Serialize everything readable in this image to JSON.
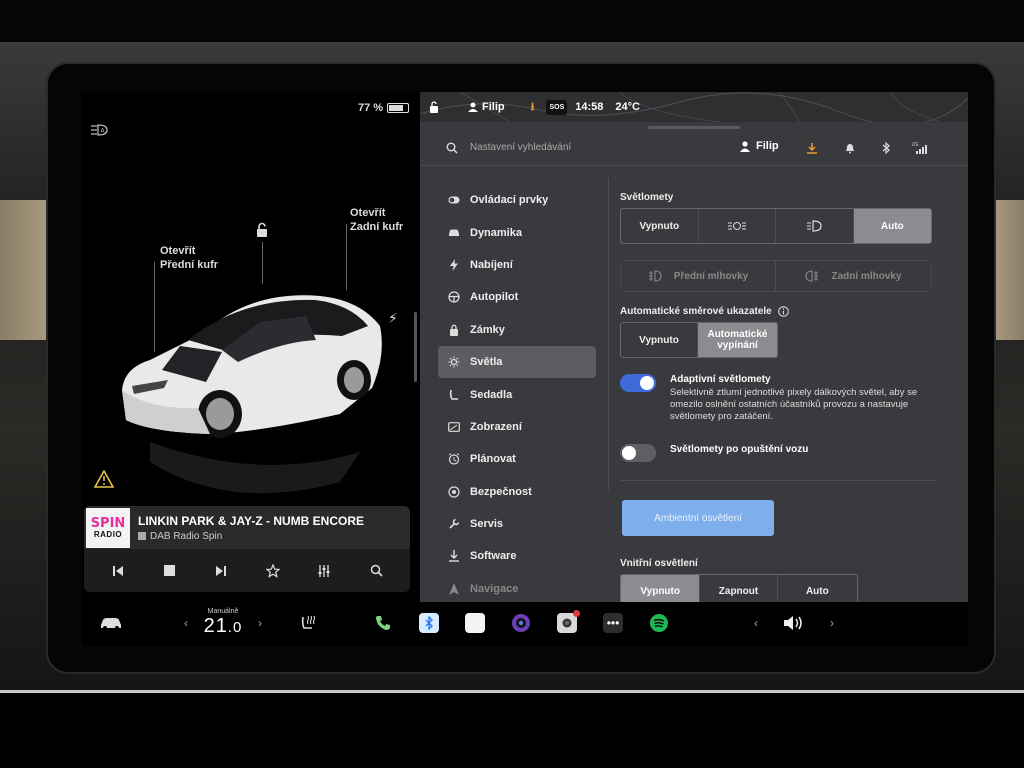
{
  "left_panel": {
    "battery_percent": "77 %",
    "battery_level": 0.77,
    "label_front_trunk": {
      "action": "Otevřít",
      "target": "Přední kufr"
    },
    "label_rear_trunk": {
      "action": "Otevřít",
      "target": "Zadní kufr"
    }
  },
  "media": {
    "logo_line1": "SPIN",
    "logo_line2": "RADIO",
    "track_title": "LINKIN PARK & JAY-Z - NUMB ENCORE",
    "station": "DAB Radio Spin",
    "controls": [
      "previous-icon",
      "stop-icon",
      "next-icon",
      "favorite-icon",
      "equalizer-icon",
      "search-icon"
    ]
  },
  "status_bar": {
    "user": "Filip",
    "sos": "SOS",
    "time": "14:58",
    "temperature": "24°C"
  },
  "search": {
    "placeholder": "Nastavení vyhledávání",
    "profile_name": "Filip"
  },
  "nav": {
    "items": [
      {
        "label": "Ovládací prvky",
        "icon": "toggle-icon"
      },
      {
        "label": "Dynamika",
        "icon": "car-icon"
      },
      {
        "label": "Nabíjení",
        "icon": "bolt-icon"
      },
      {
        "label": "Autopilot",
        "icon": "steering-wheel-icon"
      },
      {
        "label": "Zámky",
        "icon": "lock-icon"
      },
      {
        "label": "Světla",
        "icon": "sun-icon"
      },
      {
        "label": "Sedadla",
        "icon": "seat-icon"
      },
      {
        "label": "Zobrazení",
        "icon": "display-icon"
      },
      {
        "label": "Plánovat",
        "icon": "alarm-clock-icon"
      },
      {
        "label": "Bezpečnost",
        "icon": "security-icon"
      },
      {
        "label": "Servis",
        "icon": "wrench-icon"
      },
      {
        "label": "Software",
        "icon": "download-icon"
      },
      {
        "label": "Navigace",
        "icon": "navigation-icon"
      }
    ],
    "active_index": 5
  },
  "lights": {
    "headlights_title": "Světlomety",
    "headlights_options": [
      "Vypnuto",
      "",
      "",
      "Auto"
    ],
    "headlights_selected": "Auto",
    "fog_front": "Přední mlhovky",
    "fog_rear": "Zadní mlhovky",
    "turn_signals_title": "Automatické směrové ukazatele",
    "turn_signals_options": [
      "Vypnuto",
      "Automatické vypínání"
    ],
    "turn_signals_selected": "Automatické vypínání",
    "adaptive_title": "Adaptivní světlomety",
    "adaptive_desc": "Selektivně ztlumí jednotlivé pixely dálkových světel, aby se omezilo oslnění ostatních účastníků provozu a nastavuje světlomety pro zatáčení.",
    "adaptive_on": true,
    "exit_lights_title": "Světlomety po opuštění vozu",
    "exit_lights_on": false,
    "ambient_button": "Ambientní osvětlení",
    "interior_title": "Vnitřní osvětlení",
    "interior_options": [
      "Vypnuto",
      "Zapnout",
      "Auto"
    ],
    "interior_selected": "Vypnuto"
  },
  "taskbar": {
    "climate_mode": "Manuálně",
    "climate_temp_int": "21",
    "climate_temp_dec": ".0"
  },
  "colors": {
    "panel_bg": "#393a3d",
    "accent_blue": "#3d6bd8",
    "ambient_button": "#7faeed",
    "selected_segment": "#8b8c8f"
  }
}
